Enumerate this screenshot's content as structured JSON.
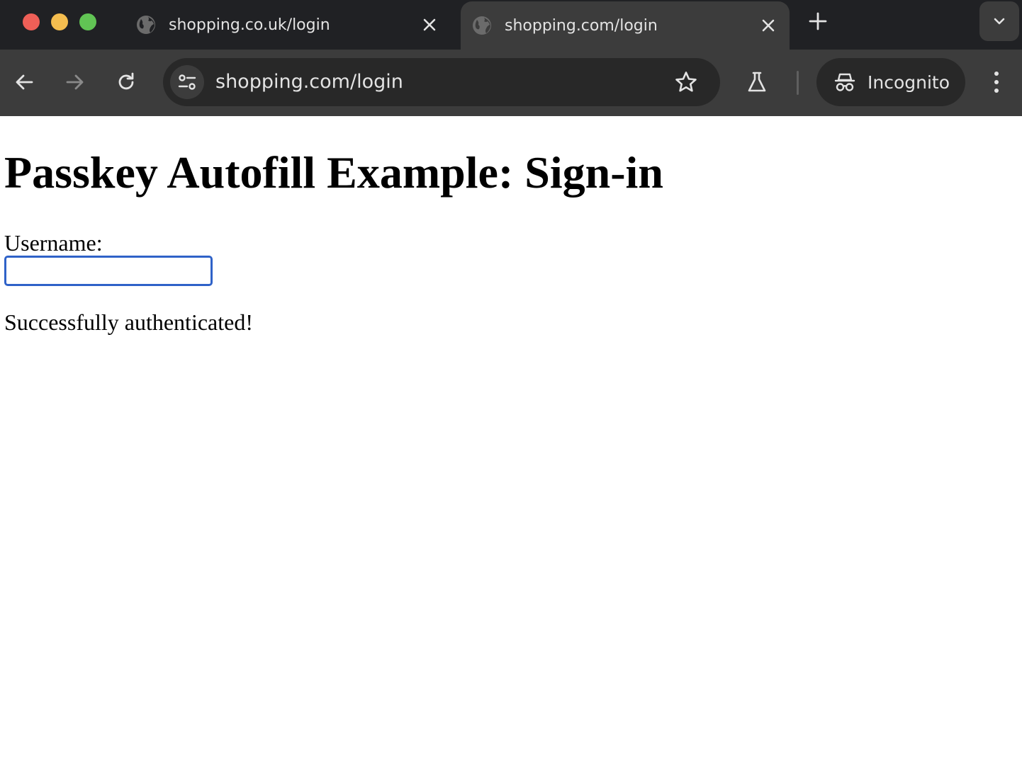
{
  "window": {
    "traffic_lights": {
      "close_color": "#ee5f57",
      "minimize_color": "#f4bd4f",
      "zoom_color": "#61c454"
    }
  },
  "tabs": [
    {
      "title": "shopping.co.uk/login",
      "active": false,
      "icon": "globe-icon"
    },
    {
      "title": "shopping.com/login",
      "active": true,
      "icon": "globe-icon"
    }
  ],
  "toolbar": {
    "url": "shopping.com/login",
    "profile_label": "Incognito"
  },
  "page": {
    "heading": "Passkey Autofill Example: Sign-in",
    "username_label": "Username:",
    "username_value": "",
    "status_message": "Successfully authenticated!"
  },
  "colors": {
    "tabstrip_bg": "#202124",
    "toolbar_bg": "#3c3c3c",
    "input_focus_border": "#2f62c8"
  }
}
